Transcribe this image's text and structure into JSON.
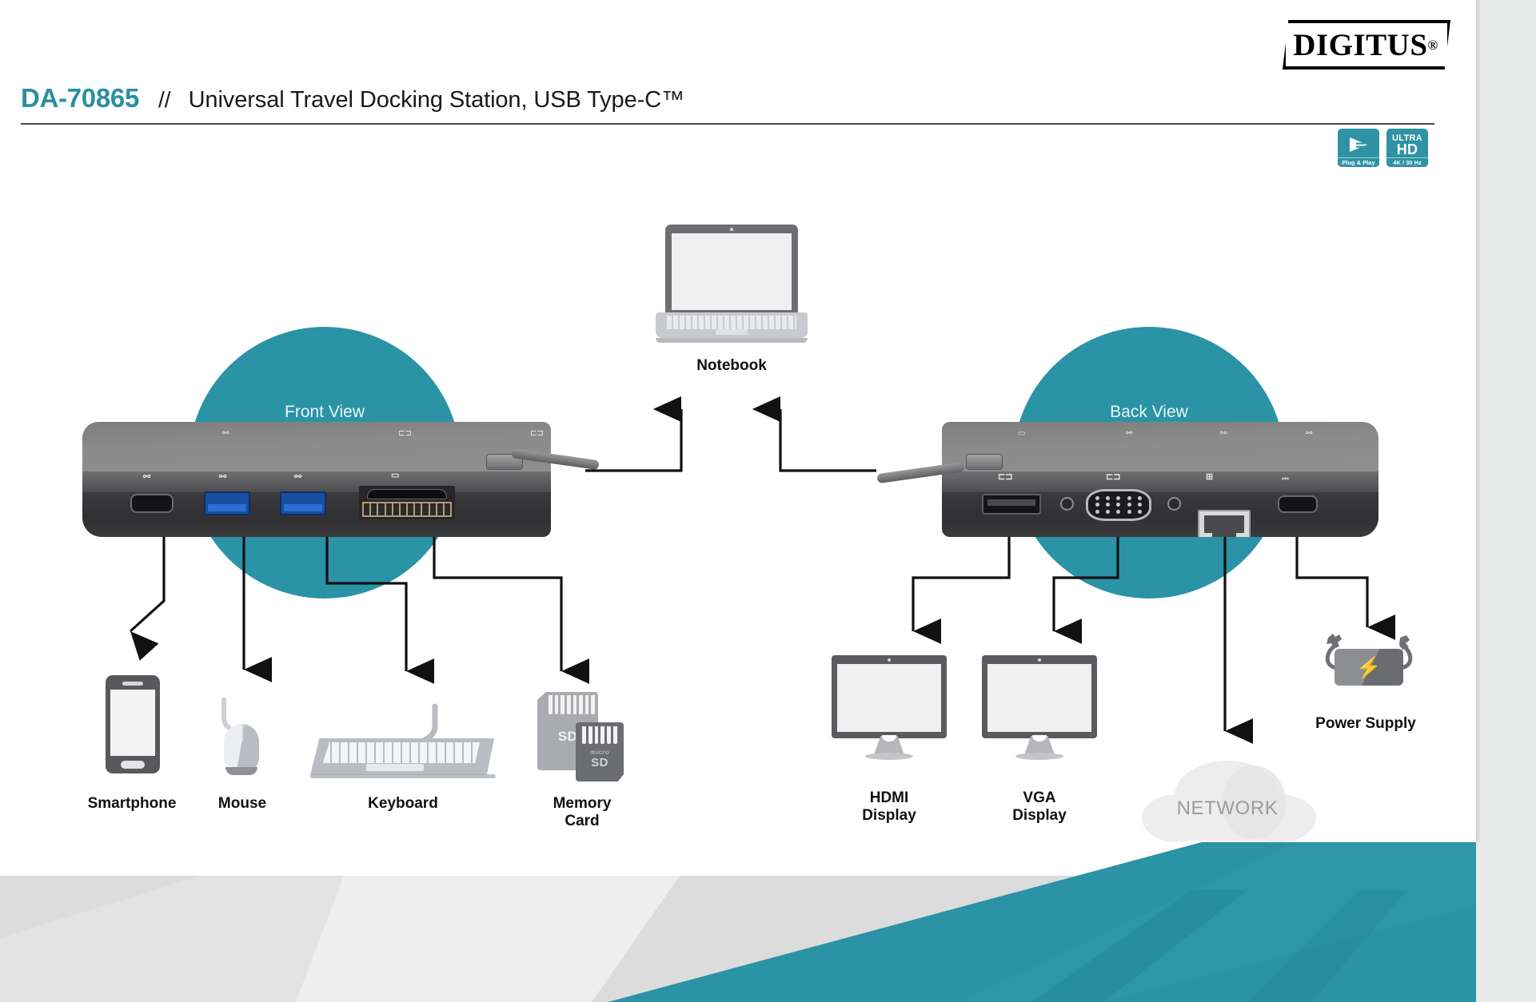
{
  "header": {
    "logo_text": "DIGITUS",
    "logo_reg": "®",
    "sku": "DA-70865",
    "separator": "//",
    "product_name": "Universal Travel Docking Station, USB Type-C™"
  },
  "badges": [
    {
      "name": "plug-and-play-badge",
      "icon": "play-arrow-icon",
      "caption": "Plug & Play"
    },
    {
      "name": "ultra-hd-badge",
      "line1": "ULTRA",
      "line2": "HD",
      "caption": "4K / 30 Hz"
    }
  ],
  "views": {
    "front_label": "Front View",
    "back_label": "Back View"
  },
  "front_ports": [
    {
      "name": "usb-c-port",
      "icon": "usb-icon"
    },
    {
      "name": "usb-3-port-1",
      "icon": "usb-icon"
    },
    {
      "name": "usb-3-port-2",
      "icon": "usb-icon"
    },
    {
      "name": "card-reader-slot",
      "icon": "sd-card-icon"
    }
  ],
  "back_ports": [
    {
      "name": "hdmi-port",
      "icon": "display-icon"
    },
    {
      "name": "vga-port",
      "icon": "display-icon"
    },
    {
      "name": "rj45-port",
      "icon": "network-icon"
    },
    {
      "name": "usb-c-power-port",
      "icon": "power-icon"
    }
  ],
  "devices": {
    "notebook": "Notebook",
    "smartphone": "Smartphone",
    "mouse": "Mouse",
    "keyboard": "Keyboard",
    "memory_card": "Memory\nCard",
    "memory_card_line1": "Memory",
    "memory_card_line2": "Card",
    "sd_label": "SD",
    "microsd_prefix": "micro",
    "microsd_label": "SD",
    "hdmi_display_line1": "HDMI",
    "hdmi_display_line2": "Display",
    "vga_display_line1": "VGA",
    "vga_display_line2": "Display",
    "network": "NETWORK",
    "power_supply": "Power Supply"
  },
  "colors": {
    "brand_teal": "#2a93a5",
    "title_teal": "#2b8fa0",
    "dock_top": "#8b8b8b",
    "dock_face": "#313133",
    "usb_blue": "#1a4fa0",
    "network_text": "#9b9b9b",
    "page_bg": "#e8e9e9"
  }
}
